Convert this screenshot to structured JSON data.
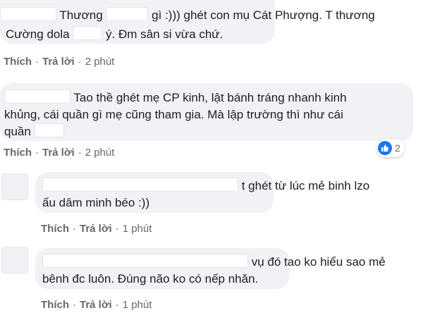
{
  "comments": [
    {
      "lines": [
        {
          "pre": "Thương",
          "mid": "gì :))) ghét con mụ Cát Phượng. T thương"
        },
        {
          "pre": "Cường dola",
          "mid": "ý. Đm sân si vừa chứ."
        }
      ],
      "like": "Thích",
      "reply": "Trả lời",
      "time": "2 phút"
    },
    {
      "lines": [
        {
          "pre": "",
          "mid": "Tao thề ghét mẹ CP kinh, lật bánh tráng nhanh kinh"
        },
        {
          "pre": "khủng, cái quần gì mẹ cũng tham gia. Mà lập trường thì như cái",
          "mid": ""
        },
        {
          "pre": "quần",
          "mid": ""
        }
      ],
      "like": "Thích",
      "reply": "Trả lời",
      "time": "2 phút",
      "reaction_count": "2"
    },
    {
      "lines": [
        {
          "pre": "",
          "mid": "t ghét từ lúc mẻ binh lzo"
        },
        {
          "pre": "ấu dâm minh béo :))",
          "mid": ""
        }
      ],
      "like": "Thích",
      "reply": "Trả lời",
      "time": "1 phút"
    },
    {
      "lines": [
        {
          "pre": "",
          "mid": "vụ đó tao ko hiểu sao mẻ"
        },
        {
          "pre": "bênh đc luôn. Đúng não ko có nếp nhăn.",
          "mid": ""
        }
      ],
      "like": "Thích",
      "reply": "Trả lời",
      "time": "1 phút"
    }
  ],
  "colors": {
    "bubble": "#f0f2f5",
    "text": "#1c1e21",
    "meta": "#65676b",
    "like_blue": "#1877f2"
  },
  "icons": {
    "reaction": "like-icon"
  }
}
